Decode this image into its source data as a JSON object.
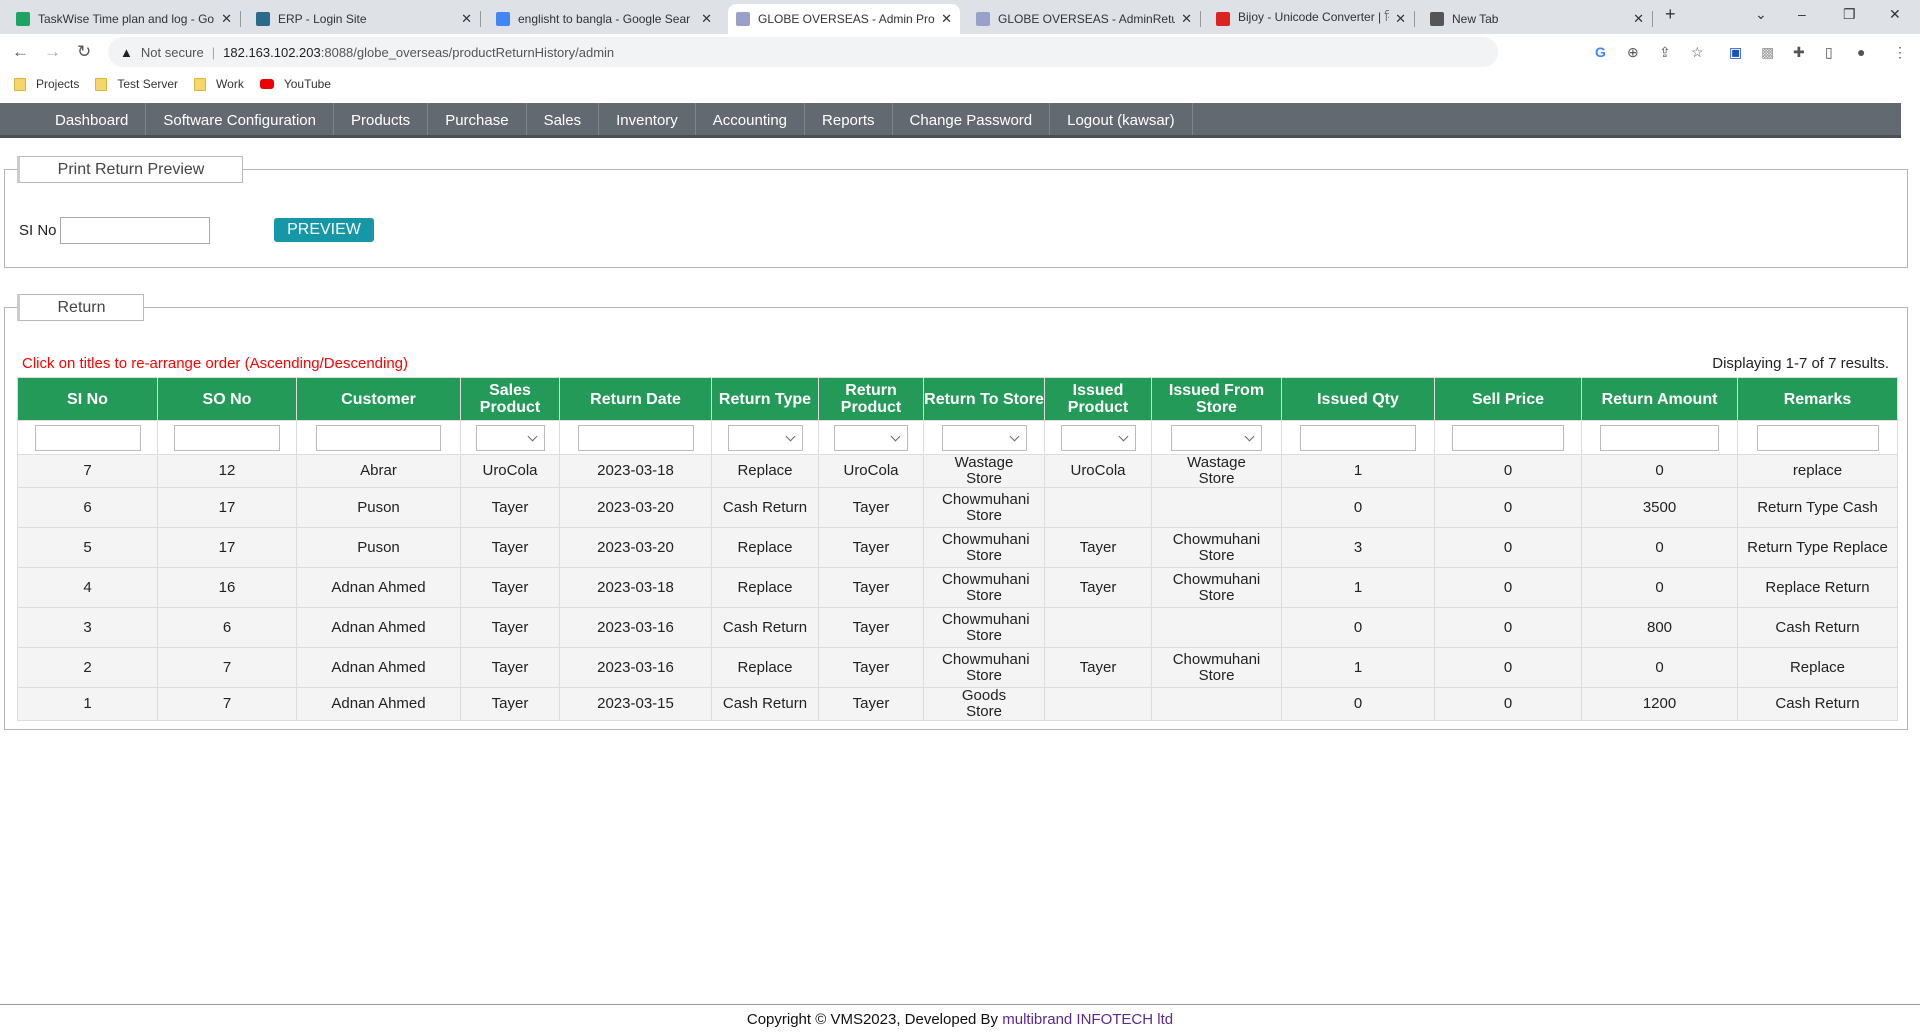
{
  "browser": {
    "tabs": [
      {
        "title": "TaskWise Time plan and log - Go",
        "icon": "sheets-icon",
        "color": "#1ea362"
      },
      {
        "title": "ERP - Login Site",
        "icon": "erp-icon",
        "color": "#2a6a8a"
      },
      {
        "title": "englisht to bangla - Google Sear",
        "icon": "google-icon",
        "color": "#4285f4"
      },
      {
        "title": "GLOBE OVERSEAS - Admin Produ",
        "icon": "gear-icon",
        "color": "#9aa0c8"
      },
      {
        "title": "GLOBE OVERSEAS - AdminRetur",
        "icon": "gear-icon",
        "color": "#9aa0c8"
      },
      {
        "title": "Bijoy - Unicode Converter | বিজ",
        "icon": "bd-emblem-icon",
        "color": "#d22"
      },
      {
        "title": "New Tab",
        "icon": "chrome-icon",
        "color": "#555"
      }
    ],
    "not_secure": "Not secure",
    "url_host": "182.163.102.203",
    "url_path": ":8088/globe_overseas/productReturnHistory/admin",
    "bookmarks": [
      "Projects",
      "Test Server",
      "Work",
      "YouTube"
    ]
  },
  "nav": [
    "Dashboard",
    "Software Configuration",
    "Products",
    "Purchase",
    "Sales",
    "Inventory",
    "Accounting",
    "Reports",
    "Change Password",
    "Logout (kawsar)"
  ],
  "print_preview": {
    "legend": "Print Return Preview",
    "si_label": "SI No",
    "si_value": "",
    "button": "PREVIEW"
  },
  "return": {
    "legend": "Return",
    "hint": "Click on titles to re-arrange order (Ascending/Descending)",
    "summary": "Displaying 1-7 of 7 results.",
    "columns": [
      "SI No",
      "SO No",
      "Customer",
      "Sales Product",
      "Return Date",
      "Return Type",
      "Return Product",
      "Return To Store",
      "Issued Product",
      "Issued From Store",
      "Issued Qty",
      "Sell Price",
      "Return Amount",
      "Remarks"
    ],
    "rows": [
      [
        "7",
        "12",
        "Abrar",
        "UroCola",
        "2023-03-18",
        "Replace",
        "UroCola",
        "Wastage Store",
        "UroCola",
        "Wastage Store",
        "1",
        "0",
        "0",
        "replace"
      ],
      [
        "6",
        "17",
        "Puson",
        "Tayer",
        "2023-03-20",
        "Cash Return",
        "Tayer",
        "Chowmuhani Store",
        "",
        "",
        "0",
        "0",
        "3500",
        "Return Type Cash"
      ],
      [
        "5",
        "17",
        "Puson",
        "Tayer",
        "2023-03-20",
        "Replace",
        "Tayer",
        "Chowmuhani Store",
        "Tayer",
        "Chowmuhani Store",
        "3",
        "0",
        "0",
        "Return Type Replace"
      ],
      [
        "4",
        "16",
        "Adnan Ahmed",
        "Tayer",
        "2023-03-18",
        "Replace",
        "Tayer",
        "Chowmuhani Store",
        "Tayer",
        "Chowmuhani Store",
        "1",
        "0",
        "0",
        "Replace Return"
      ],
      [
        "3",
        "6",
        "Adnan Ahmed",
        "Tayer",
        "2023-03-16",
        "Cash Return",
        "Tayer",
        "Chowmuhani Store",
        "",
        "",
        "0",
        "0",
        "800",
        "Cash Return"
      ],
      [
        "2",
        "7",
        "Adnan Ahmed",
        "Tayer",
        "2023-03-16",
        "Replace",
        "Tayer",
        "Chowmuhani Store",
        "Tayer",
        "Chowmuhani Store",
        "1",
        "0",
        "0",
        "Replace"
      ],
      [
        "1",
        "7",
        "Adnan Ahmed",
        "Tayer",
        "2023-03-15",
        "Cash Return",
        "Tayer",
        "Goods Store",
        "",
        "",
        "0",
        "0",
        "1200",
        "Cash Return"
      ]
    ]
  },
  "footer": {
    "copyright": "Copyright © VMS2023, Developed By ",
    "developer": "multibrand INFOTECH ltd"
  }
}
